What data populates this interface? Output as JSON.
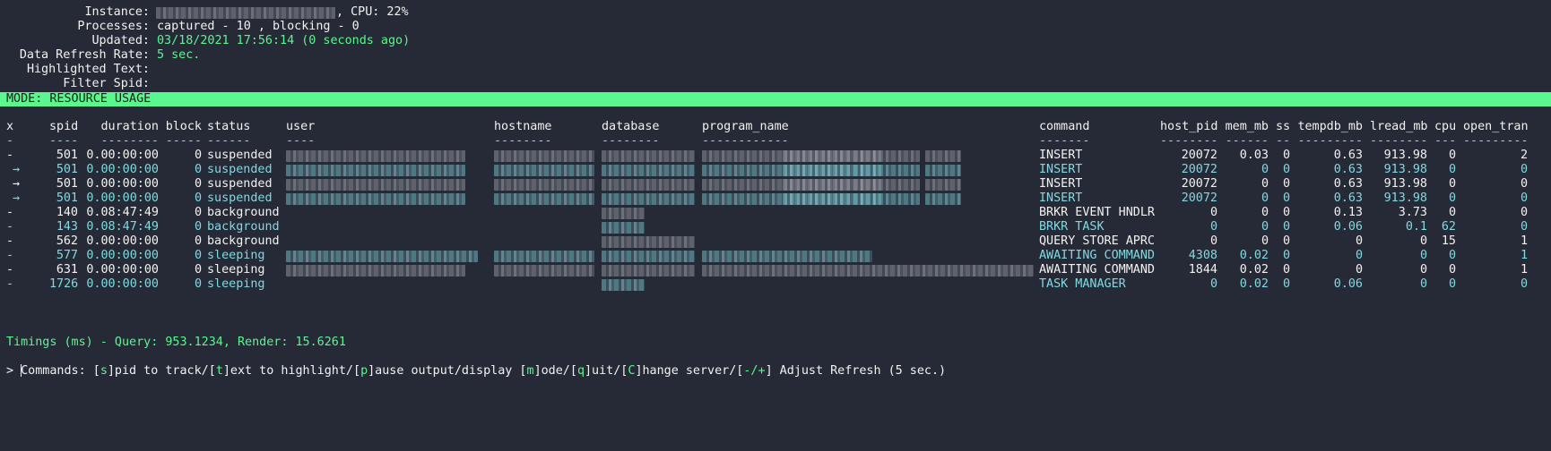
{
  "header": {
    "instance_label": "Instance:",
    "cpu_text": ", CPU: 22%",
    "processes_label": "Processes:",
    "processes_value": "captured - 10 , blocking - 0",
    "updated_label": "Updated:",
    "updated_value": "03/18/2021 17:56:14 (0 seconds ago)",
    "refresh_label": "Data Refresh Rate:",
    "refresh_value": "5 sec.",
    "highlight_label": "Highlighted Text:",
    "filter_label": "Filter Spid:"
  },
  "mode_bar": "MODE: RESOURCE USAGE",
  "columns": [
    "x",
    "spid",
    "duration",
    "block",
    "status",
    "user",
    "hostname",
    "database",
    "program_name",
    "command",
    "host_pid",
    "mem_mb",
    "ss",
    "tempdb_mb",
    "lread_mb",
    "cpu",
    "open_tran"
  ],
  "underlines": [
    "-",
    "----",
    "--------",
    "-----",
    "------",
    "----",
    "--------",
    "--------",
    "------------",
    "-------",
    "--------",
    "------",
    "--",
    "---------",
    "--------",
    "---",
    "---------"
  ],
  "rows": [
    {
      "x": "-",
      "spid": "501",
      "duration": "0.00:00:00",
      "block": "0",
      "status": "suspended",
      "command": "INSERT",
      "host_pid": "20072",
      "mem_mb": "0.03",
      "ss": "0",
      "tempdb_mb": "0.63",
      "lread_mb": "913.98",
      "cpu": "0",
      "open_tran": "2",
      "color": "#f2f2f2"
    },
    {
      "x": "→",
      "spid": "501",
      "duration": "0.00:00:00",
      "block": "0",
      "status": "suspended",
      "command": "INSERT",
      "host_pid": "20072",
      "mem_mb": "0",
      "ss": "0",
      "tempdb_mb": "0.63",
      "lread_mb": "913.98",
      "cpu": "0",
      "open_tran": "0",
      "color": "#7fdbe0"
    },
    {
      "x": "→",
      "spid": "501",
      "duration": "0.00:00:00",
      "block": "0",
      "status": "suspended",
      "command": "INSERT",
      "host_pid": "20072",
      "mem_mb": "0",
      "ss": "0",
      "tempdb_mb": "0.63",
      "lread_mb": "913.98",
      "cpu": "0",
      "open_tran": "0",
      "color": "#f2f2f2"
    },
    {
      "x": "→",
      "spid": "501",
      "duration": "0.00:00:00",
      "block": "0",
      "status": "suspended",
      "command": "INSERT",
      "host_pid": "20072",
      "mem_mb": "0",
      "ss": "0",
      "tempdb_mb": "0.63",
      "lread_mb": "913.98",
      "cpu": "0",
      "open_tran": "0",
      "color": "#7fdbe0"
    },
    {
      "x": "-",
      "spid": "140",
      "duration": "0.08:47:49",
      "block": "0",
      "status": "background",
      "command": "BRKR EVENT HNDLR",
      "host_pid": "0",
      "mem_mb": "0",
      "ss": "0",
      "tempdb_mb": "0.13",
      "lread_mb": "3.73",
      "cpu": "0",
      "open_tran": "0",
      "color": "#f2f2f2"
    },
    {
      "x": "-",
      "spid": "143",
      "duration": "0.08:47:49",
      "block": "0",
      "status": "background",
      "command": "BRKR TASK",
      "host_pid": "0",
      "mem_mb": "0",
      "ss": "0",
      "tempdb_mb": "0.06",
      "lread_mb": "0.1",
      "cpu": "62",
      "open_tran": "0",
      "color": "#7fdbe0"
    },
    {
      "x": "-",
      "spid": "562",
      "duration": "0.00:00:00",
      "block": "0",
      "status": "background",
      "command": "QUERY STORE APRC",
      "host_pid": "0",
      "mem_mb": "0",
      "ss": "0",
      "tempdb_mb": "0",
      "lread_mb": "0",
      "cpu": "15",
      "open_tran": "1",
      "color": "#f2f2f2"
    },
    {
      "x": "-",
      "spid": "577",
      "duration": "0.00:00:00",
      "block": "0",
      "status": "sleeping",
      "command": "AWAITING COMMAND",
      "host_pid": "4308",
      "mem_mb": "0.02",
      "ss": "0",
      "tempdb_mb": "0",
      "lread_mb": "0",
      "cpu": "0",
      "open_tran": "1",
      "color": "#7fdbe0"
    },
    {
      "x": "-",
      "spid": "631",
      "duration": "0.00:00:00",
      "block": "0",
      "status": "sleeping",
      "command": "AWAITING COMMAND",
      "host_pid": "1844",
      "mem_mb": "0.02",
      "ss": "0",
      "tempdb_mb": "0",
      "lread_mb": "0",
      "cpu": "0",
      "open_tran": "1",
      "color": "#f2f2f2"
    },
    {
      "x": "-",
      "spid": "1726",
      "duration": "0.00:00:00",
      "block": "0",
      "status": "sleeping",
      "command": "TASK MANAGER",
      "host_pid": "0",
      "mem_mb": "0.02",
      "ss": "0",
      "tempdb_mb": "0.06",
      "lread_mb": "0",
      "cpu": "0",
      "open_tran": "0",
      "color": "#7fdbe0"
    }
  ],
  "footer": {
    "timings": "Timings (ms) - Query: 953.1234, Render: 15.6261",
    "commands_parts": [
      "Commands: [",
      "s",
      "]pid to track/[",
      "t",
      "]ext to highlight/[",
      "p",
      "]ause output/display [",
      "m",
      "]ode/[",
      "q",
      "]uit/[",
      "C",
      "]hange server/[",
      "-/+",
      "] Adjust Refresh (5 sec.)"
    ],
    "prompt": "> "
  },
  "colors": {
    "background": "#262936",
    "accent_green": "#5af78e",
    "cyan": "#7fdbe0",
    "text": "#f2f2f2"
  }
}
